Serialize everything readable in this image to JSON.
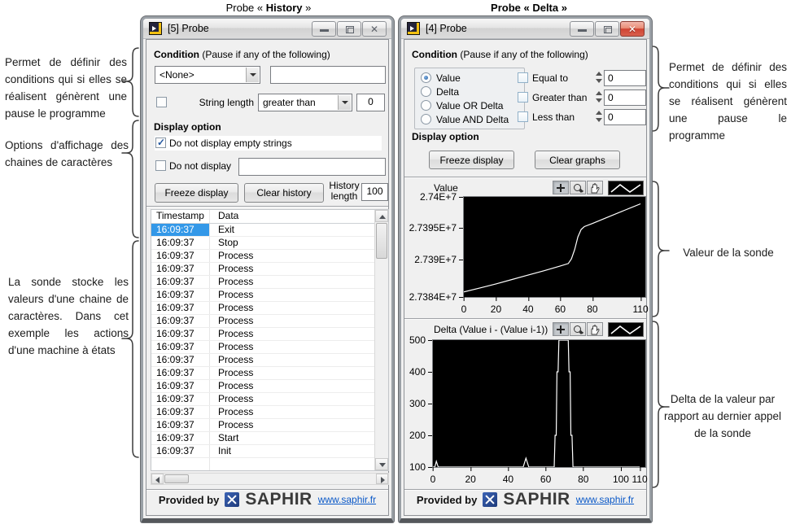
{
  "captions": {
    "history": {
      "prefix": "Probe « ",
      "bold": "History",
      "suffix": " »"
    },
    "delta": {
      "text": "Probe « Delta »"
    }
  },
  "annotations": {
    "left": [
      {
        "text": "Permet de définir des conditions qui si elles se réalisent génèrent une pause le programme"
      },
      {
        "text": "Options d'affichage des chaines de caractères"
      },
      {
        "text": "La sonde stocke les valeurs d'une chaine de caractères. Dans cet exemple les actions d'une machine à états"
      }
    ],
    "right": [
      {
        "text": "Permet de définir des conditions qui si elles se réalisent génèrent une pause le programme"
      },
      {
        "text": "Valeur de la sonde"
      },
      {
        "text": "Delta de la valeur par rapport au dernier appel de la sonde"
      }
    ]
  },
  "history_window": {
    "title": "[5] Probe",
    "condition": {
      "heading": "Condition",
      "heading_note": " (Pause if any of the following)",
      "selector_value": "<None>",
      "condition_text": "",
      "string_length_label": "String length",
      "operator": "greater than",
      "operator_value": "0"
    },
    "display": {
      "heading": "Display option",
      "empty_strings_label": "Do not display empty strings",
      "do_not_display_label": "Do not display",
      "do_not_display_value": ""
    },
    "buttons": {
      "freeze": "Freeze display",
      "clear": "Clear history"
    },
    "history_length": {
      "label_line1": "History",
      "label_line2": "length",
      "value": "100"
    },
    "table": {
      "columns": [
        "Timestamp",
        "Data"
      ],
      "selected_row": 0,
      "rows": [
        [
          "16:09:37",
          "Exit"
        ],
        [
          "16:09:37",
          "Stop"
        ],
        [
          "16:09:37",
          "Process"
        ],
        [
          "16:09:37",
          "Process"
        ],
        [
          "16:09:37",
          "Process"
        ],
        [
          "16:09:37",
          "Process"
        ],
        [
          "16:09:37",
          "Process"
        ],
        [
          "16:09:37",
          "Process"
        ],
        [
          "16:09:37",
          "Process"
        ],
        [
          "16:09:37",
          "Process"
        ],
        [
          "16:09:37",
          "Process"
        ],
        [
          "16:09:37",
          "Process"
        ],
        [
          "16:09:37",
          "Process"
        ],
        [
          "16:09:37",
          "Process"
        ],
        [
          "16:09:37",
          "Process"
        ],
        [
          "16:09:37",
          "Process"
        ],
        [
          "16:09:37",
          "Start"
        ],
        [
          "16:09:37",
          "Init"
        ]
      ]
    },
    "footer": {
      "provided_by": "Provided by",
      "brand": "SAPHIR",
      "link": "www.saphir.fr"
    }
  },
  "delta_window": {
    "title": "[4] Probe",
    "condition": {
      "heading": "Condition",
      "heading_note": " (Pause if any of the following)",
      "radio_options": [
        "Value",
        "Delta",
        "Value OR Delta",
        "Value AND Delta"
      ],
      "selected_radio": 0,
      "checks": [
        {
          "label": "Equal to",
          "value": "0"
        },
        {
          "label": "Greater than",
          "value": "0"
        },
        {
          "label": "Less than",
          "value": "0"
        }
      ]
    },
    "display": {
      "heading": "Display option"
    },
    "buttons": {
      "freeze": "Freeze display",
      "clear": "Clear graphs"
    },
    "footer": {
      "provided_by": "Provided by",
      "brand": "SAPHIR",
      "link": "www.saphir.fr"
    }
  },
  "colors": {
    "selection": "#3398e8",
    "plot_background": "#000000",
    "plot_line": "#ffffff",
    "link": "#0a58c7"
  },
  "chart_data": [
    {
      "type": "line",
      "title": "Value",
      "xlabel": "",
      "ylabel": "",
      "grid": false,
      "bg_color": "#000000",
      "line_color": "#ffffff",
      "xlim": [
        0,
        113
      ],
      "ylim": [
        27384000,
        27400000
      ],
      "ytick_values": [
        27400000,
        27395000,
        27390000,
        27384000
      ],
      "ytick_labels": [
        "2.74E+7",
        "2.7395E+7",
        "2.739E+7",
        "2.7384E+7"
      ],
      "xtick_values": [
        0,
        20,
        40,
        60,
        80,
        110
      ],
      "xtick_labels": [
        "0",
        "20",
        "40",
        "60",
        "80",
        "110"
      ],
      "series": [
        {
          "name": "Value",
          "points": [
            [
              0,
              27384800
            ],
            [
              10,
              27385450
            ],
            [
              20,
              27386100
            ],
            [
              30,
              27386800
            ],
            [
              40,
              27387500
            ],
            [
              50,
              27388200
            ],
            [
              60,
              27388950
            ],
            [
              65,
              27389350
            ],
            [
              67,
              27390100
            ],
            [
              69,
              27391600
            ],
            [
              71,
              27393600
            ],
            [
              73,
              27394800
            ],
            [
              75,
              27395250
            ],
            [
              80,
              27395750
            ],
            [
              90,
              27396800
            ],
            [
              100,
              27397850
            ],
            [
              110,
              27398900
            ]
          ]
        }
      ]
    },
    {
      "type": "line",
      "title": "Delta (Value i - (Value i-1))",
      "xlabel": "",
      "ylabel": "",
      "grid": false,
      "bg_color": "#000000",
      "line_color": "#ffffff",
      "xlim": [
        0,
        113
      ],
      "ylim": [
        100,
        500
      ],
      "ytick_values": [
        500,
        400,
        300,
        200,
        100
      ],
      "ytick_labels": [
        "500",
        "400",
        "300",
        "200",
        "100"
      ],
      "xtick_values": [
        0,
        20,
        40,
        60,
        80,
        100,
        110
      ],
      "xtick_labels": [
        "0",
        "20",
        "40",
        "60",
        "80",
        "100",
        "110"
      ],
      "series": [
        {
          "name": "Delta",
          "points": [
            [
              0,
              100
            ],
            [
              1,
              100
            ],
            [
              1.8,
              118
            ],
            [
              2.8,
              100
            ],
            [
              48,
              100
            ],
            [
              49.5,
              128
            ],
            [
              51,
              100
            ],
            [
              64.5,
              100
            ],
            [
              65,
              200
            ],
            [
              65.6,
              200
            ],
            [
              66,
              400
            ],
            [
              66.6,
              400
            ],
            [
              67,
              500
            ],
            [
              72,
              500
            ],
            [
              72.4,
              400
            ],
            [
              73,
              400
            ],
            [
              73.4,
              200
            ],
            [
              74,
              200
            ],
            [
              74.5,
              100
            ],
            [
              110,
              100
            ]
          ]
        }
      ]
    }
  ]
}
